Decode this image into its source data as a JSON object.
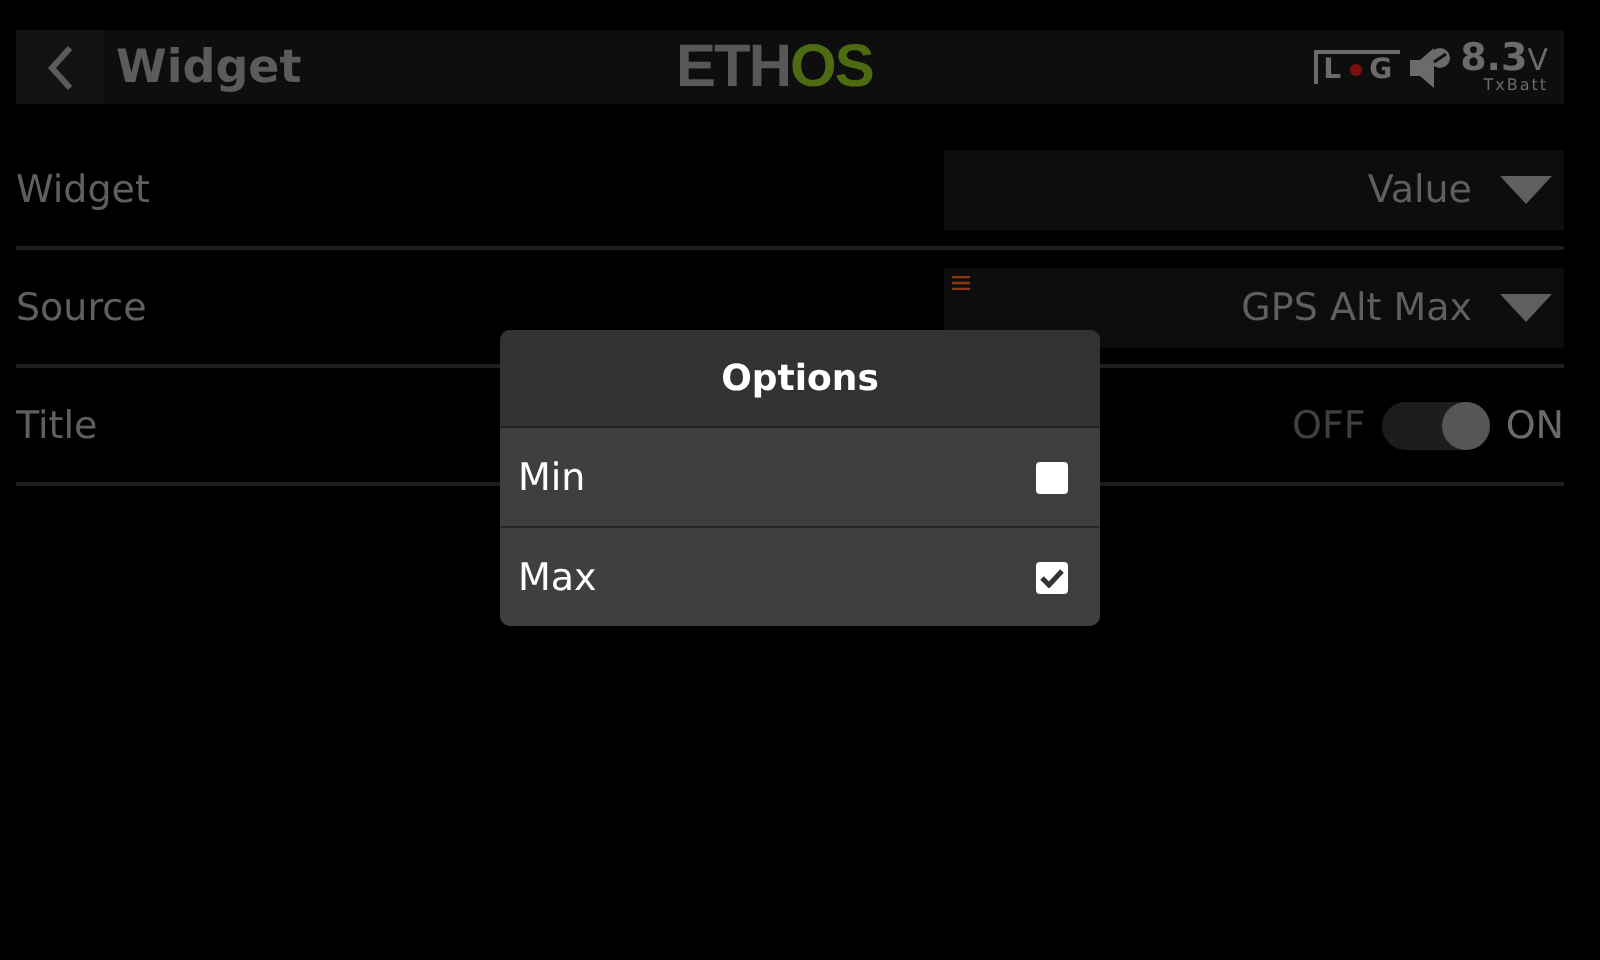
{
  "header": {
    "title": "Widget",
    "logo": {
      "gray_part": "ETH",
      "green_part": "OS"
    },
    "log_indicator": {
      "left": "L",
      "right": "G",
      "recording": true
    },
    "battery": {
      "value": "8.3",
      "unit": "V",
      "label": "TxBatt"
    }
  },
  "fields": [
    {
      "kind": "dropdown",
      "label": "Widget",
      "value": "Value",
      "has_source_marker": false
    },
    {
      "kind": "dropdown",
      "label": "Source",
      "value": "GPS Alt Max",
      "has_source_marker": true
    },
    {
      "kind": "toggle",
      "label": "Title",
      "off_label": "OFF",
      "on_label": "ON",
      "on": true
    }
  ],
  "dialog": {
    "title": "Options",
    "items": [
      {
        "label": "Min",
        "checked": false
      },
      {
        "label": "Max",
        "checked": true
      }
    ]
  }
}
